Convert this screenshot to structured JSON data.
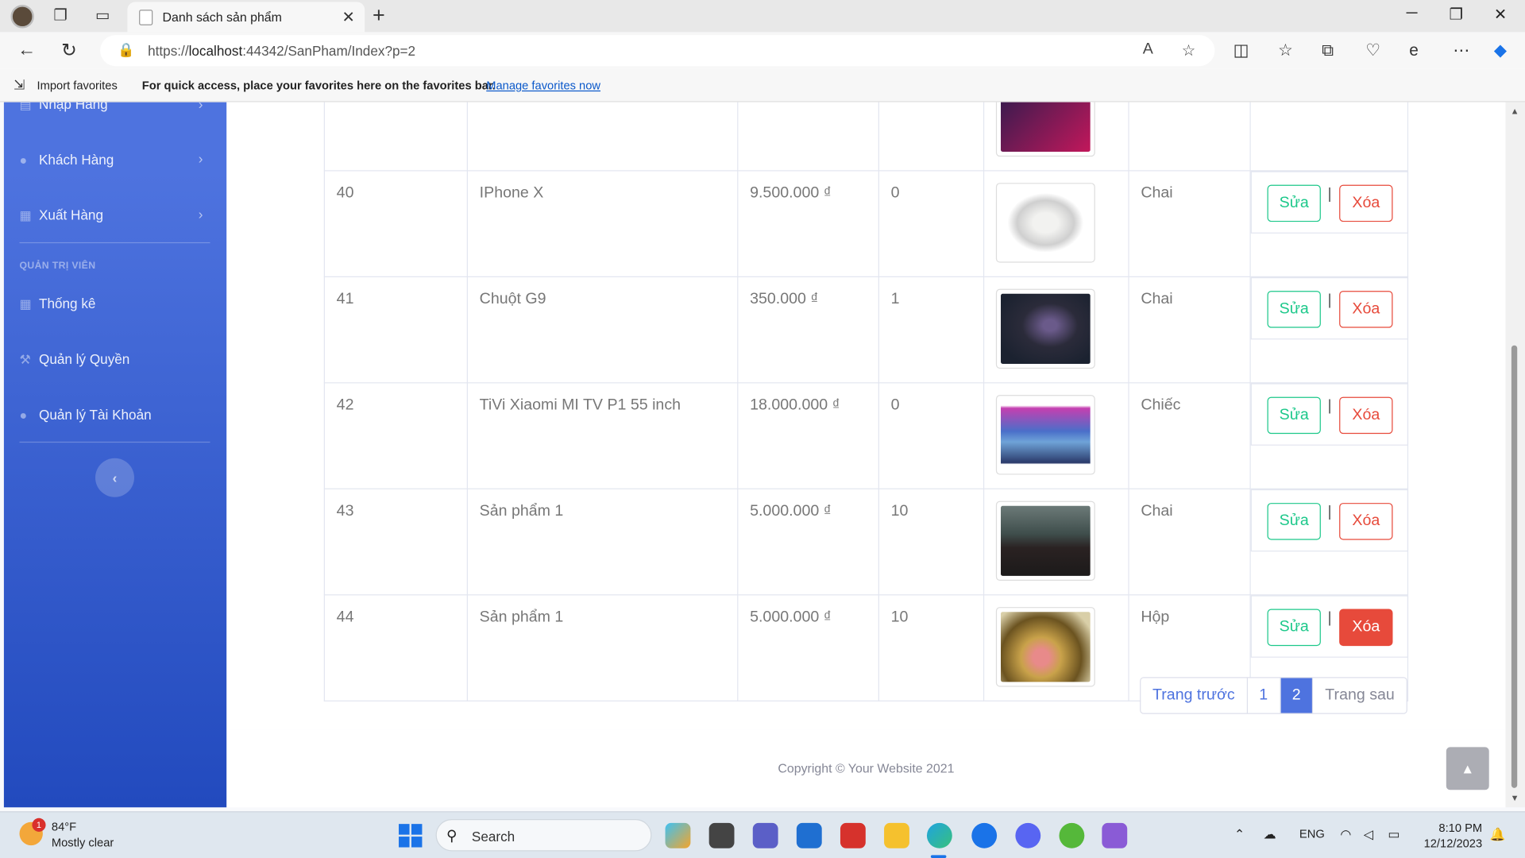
{
  "browser": {
    "tab_title": "Danh sách sản phẩm",
    "url_prefix": "https://",
    "url_host": "localhost",
    "url_rest": ":44342/SanPham/Index?p=2",
    "favorites": {
      "import_label": "Import favorites",
      "message": "For quick access, place your favorites here on the favorites bar.",
      "manage_link": "Manage favorites now"
    }
  },
  "sidebar": {
    "items": [
      {
        "label": "Nhập Hàng",
        "icon": "truck-icon"
      },
      {
        "label": "Khách Hàng",
        "icon": "users-icon"
      },
      {
        "label": "Xuất Hàng",
        "icon": "export-icon"
      }
    ],
    "admin_heading": "QUẢN TRỊ VIÊN",
    "admin_items": [
      {
        "label": "Thống kê",
        "icon": "calculator-icon"
      },
      {
        "label": "Quản lý Quyền",
        "icon": "hammer-icon"
      },
      {
        "label": "Quản lý Tài Khoản",
        "icon": "user-icon"
      }
    ],
    "toggle_icon": "chevron-left-icon"
  },
  "products": [
    {
      "id": "40",
      "name": "IPhone X",
      "price": "9.500.000 ₫",
      "qty": "0",
      "unit": "Chai",
      "image": "iphone-photo",
      "delete_style": "outline"
    },
    {
      "id": "41",
      "name": "Chuột G9",
      "price": "350.000 ₫",
      "qty": "1",
      "unit": "Chai",
      "image": "mouse-photo",
      "delete_style": "outline"
    },
    {
      "id": "42",
      "name": "TiVi Xiaomi MI TV P1 55 inch",
      "price": "18.000.000 ₫",
      "qty": "0",
      "unit": "Chiếc",
      "image": "tv-photo",
      "delete_style": "outline"
    },
    {
      "id": "43",
      "name": "Sản phẩm 1",
      "price": "5.000.000 ₫",
      "qty": "10",
      "unit": "Chai",
      "image": "group-photo",
      "delete_style": "outline"
    },
    {
      "id": "44",
      "name": "Sản phẩm 1",
      "price": "5.000.000 ₫",
      "qty": "10",
      "unit": "Hộp",
      "image": "gift-photo",
      "delete_style": "solid"
    }
  ],
  "actions": {
    "edit_label": "Sửa",
    "delete_label": "Xóa",
    "separator": "|"
  },
  "pagination": {
    "prev": "Trang trước",
    "pages": [
      "1",
      "2"
    ],
    "active_page": "2",
    "next": "Trang sau"
  },
  "footer": {
    "copyright": "Copyright © Your Website 2021"
  },
  "taskbar": {
    "weather_temp": "84°F",
    "weather_desc": "Mostly clear",
    "weather_badge": "1",
    "search_label": "Search",
    "language": "ENG",
    "time": "8:10 PM",
    "date": "12/12/2023"
  },
  "colors": {
    "primary": "#4e73df",
    "success": "#1cc88a",
    "danger": "#e74a3b"
  }
}
